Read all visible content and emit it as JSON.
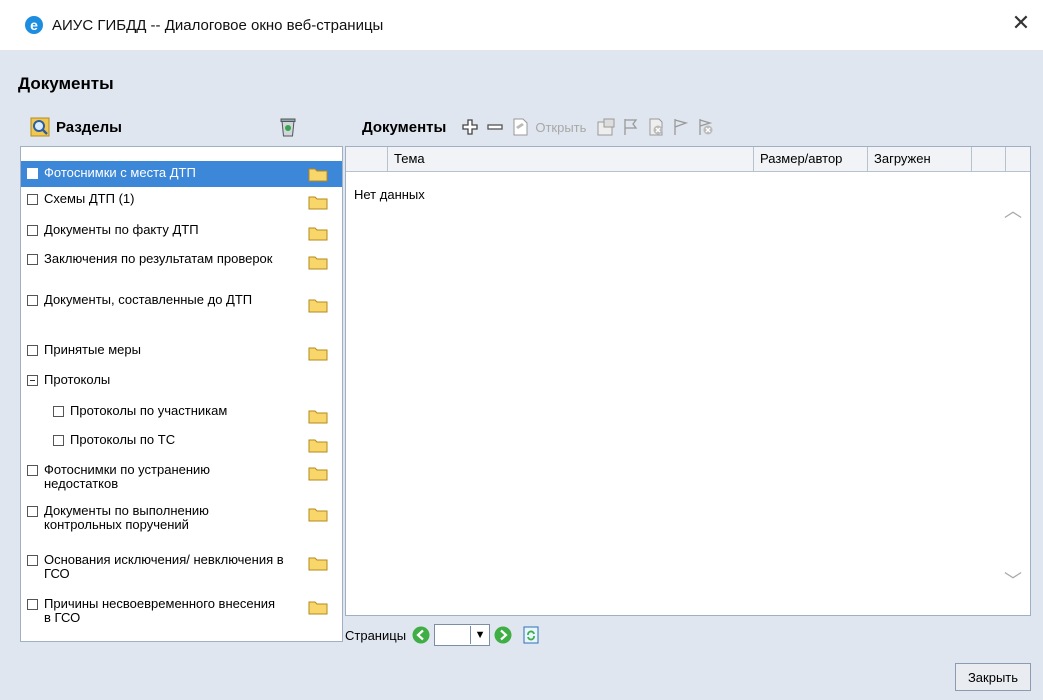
{
  "window": {
    "title": "АИУС ГИБДД -- Диалоговое окно веб-страницы"
  },
  "page": {
    "title": "Документы"
  },
  "sections": {
    "title": "Разделы",
    "items": [
      {
        "label": "Фотоснимки с места ДТП",
        "selected": true
      },
      {
        "label": "Схемы ДТП (1)"
      },
      {
        "label": "Документы по факту ДТП"
      },
      {
        "label": "Заключения по результатам проверок"
      },
      {
        "label": "Документы, составленные до ДТП"
      },
      {
        "label": "Принятые меры"
      },
      {
        "label": "Протоколы"
      },
      {
        "label": "Протоколы по участникам"
      },
      {
        "label": "Протоколы по ТС"
      },
      {
        "label": "Фотоснимки по устранению недостатков"
      },
      {
        "label": "Документы по выполнению контрольных поручений"
      },
      {
        "label": "Основания исключения/ невключения в ГСО"
      },
      {
        "label": "Причины несвоевременного внесения в ГСО"
      }
    ]
  },
  "documents": {
    "title": "Документы",
    "open_label": "Открыть",
    "columns": [
      "Тема",
      "Размер/автор",
      "Загружен"
    ],
    "empty_text": "Нет данных"
  },
  "pager": {
    "label": "Страницы"
  },
  "footer": {
    "close_label": "Закрыть"
  }
}
